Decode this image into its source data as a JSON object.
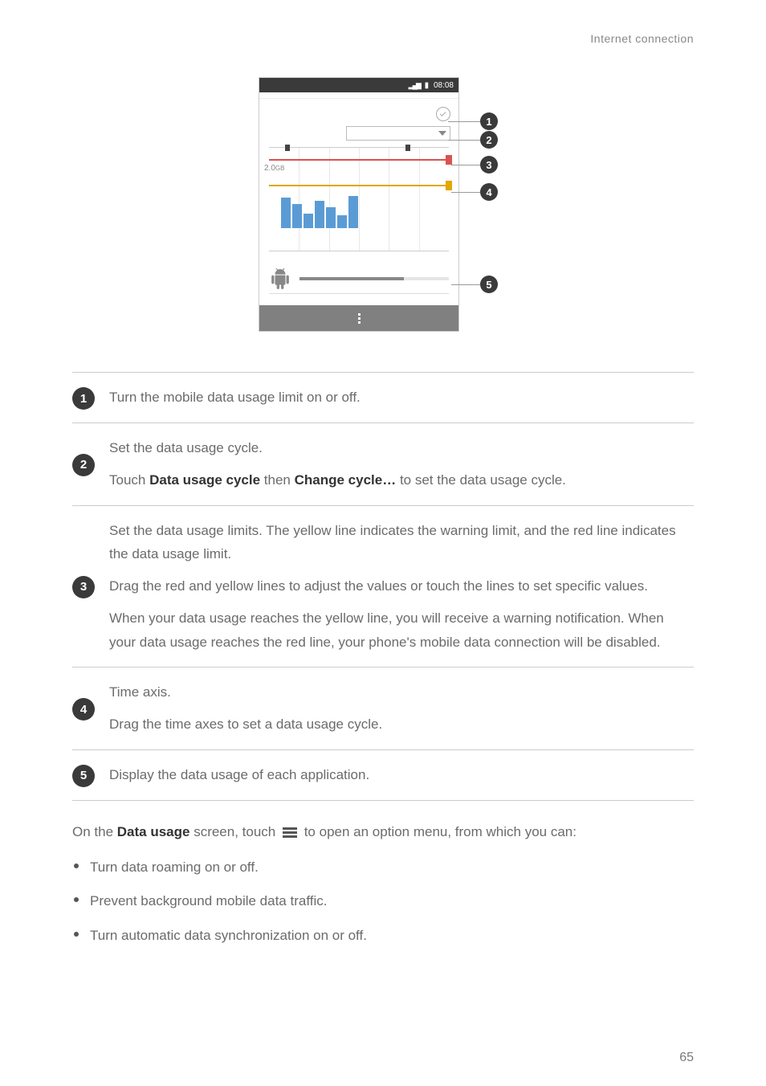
{
  "header_section": "Internet connection",
  "phone": {
    "status_time": "08:08",
    "chart_y_label": "2.0",
    "chart_y_suffix": "GB"
  },
  "callout_labels": {
    "n1": "1",
    "n2": "2",
    "n3": "3",
    "n4": "4",
    "n5": "5"
  },
  "legend": {
    "r1": {
      "num": "1",
      "p1": "Turn the mobile data usage limit on or off."
    },
    "r2": {
      "num": "2",
      "p1": "Set the data usage cycle.",
      "p2a": "Touch ",
      "p2b": "Data usage cycle",
      "p2c": " then ",
      "p2d": "Change cycle…",
      "p2e": " to set the data usage cycle."
    },
    "r3": {
      "num": "3",
      "p1": "Set the data usage limits. The yellow line indicates the warning limit, and the red line indicates the data usage limit.",
      "p2": "Drag the red and yellow lines to adjust the values or touch the lines to set specific values.",
      "p3": "When your data usage reaches the yellow line, you will receive a warning notification. When your data usage reaches the red line, your phone's mobile data connection will be disabled."
    },
    "r4": {
      "num": "4",
      "p1": "Time axis.",
      "p2": "Drag the time axes to set a data usage cycle."
    },
    "r5": {
      "num": "5",
      "p1": "Display the data usage of each application."
    }
  },
  "after": {
    "t1": "On the ",
    "t2": "Data usage",
    "t3": " screen, touch ",
    "t4": " to open an option menu, from which you can:"
  },
  "bullets": {
    "b1": "Turn data roaming on or off.",
    "b2": "Prevent background mobile data traffic.",
    "b3": "Turn automatic data synchronization on or off."
  },
  "page_number": "65",
  "chart_data": {
    "type": "bar",
    "y_warning_line": 2.0,
    "y_limit_line": 3.0,
    "ylim": [
      0,
      3.5
    ],
    "bars": [
      1.2,
      1.0,
      0.6,
      1.1,
      0.9,
      0.5,
      1.3
    ]
  }
}
